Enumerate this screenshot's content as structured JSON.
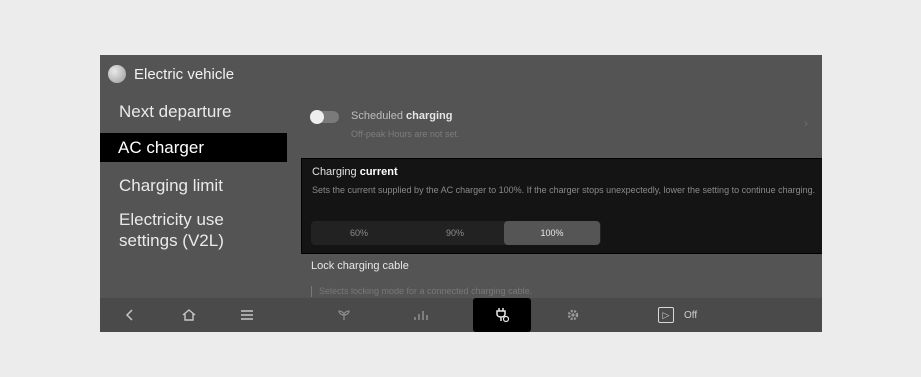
{
  "header": {
    "title": "Electric vehicle"
  },
  "sidebar": {
    "items": [
      {
        "label": "Next departure"
      },
      {
        "label": "AC charger"
      },
      {
        "label": "Charging limit"
      },
      {
        "label": "Electricity use\nsettings (V2L)"
      }
    ],
    "active_index": 1
  },
  "scheduled": {
    "title_prefix": "Scheduled ",
    "title_bold": "charging",
    "subtitle": "Off-peak Hours are not set.",
    "enabled": false
  },
  "charging_current": {
    "title_prefix": "Charging ",
    "title_bold": "current",
    "description": "Sets the current supplied by the AC charger to 100%. If the charger stops unexpectedly, lower the setting to continue charging.",
    "options": [
      "60%",
      "90%",
      "100%"
    ],
    "selected": "100%"
  },
  "lock_cable": {
    "title": "Lock charging cable",
    "subtitle": "Selects locking mode for a connected charging cable."
  },
  "navbar": {
    "icons": [
      "back-icon",
      "home-icon",
      "menu-icon",
      "eco-icon",
      "energy-bars-icon",
      "ev-charging-plug-icon",
      "gear-icon",
      "play-icon"
    ],
    "play_status": "Off",
    "selected_icon": "ev-charging-plug-icon"
  }
}
